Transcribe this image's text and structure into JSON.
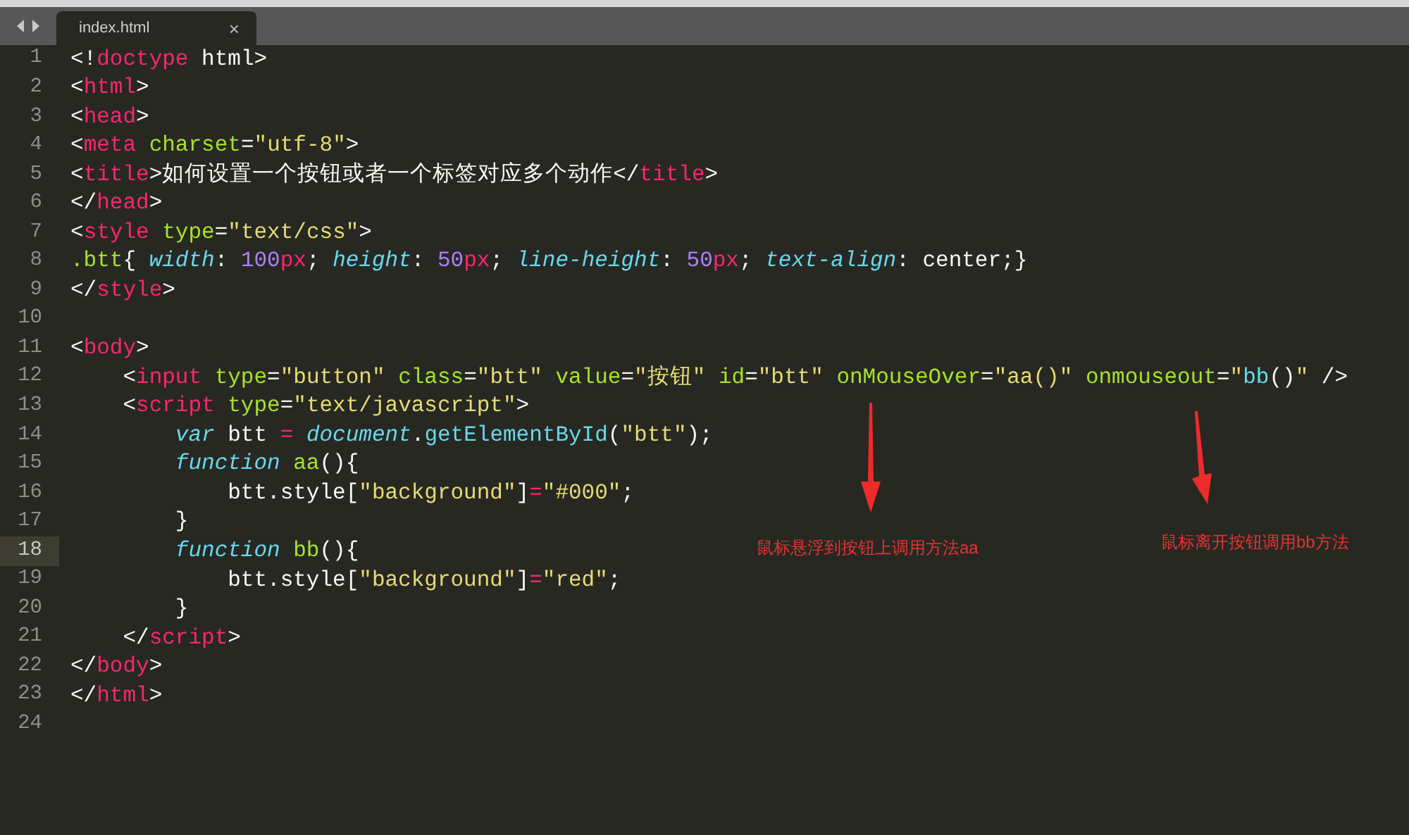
{
  "tab": {
    "title": "index.html",
    "close": "×"
  },
  "lines": [
    {
      "number": "1",
      "current": false,
      "tokens": [
        {
          "kind": "plain",
          "text": "<!"
        },
        {
          "kind": "tag",
          "text": "doctype"
        },
        {
          "kind": "plain",
          "text": " html>"
        }
      ]
    },
    {
      "number": "2",
      "current": false,
      "tokens": [
        {
          "kind": "plain",
          "text": "<"
        },
        {
          "kind": "tag",
          "text": "html"
        },
        {
          "kind": "plain",
          "text": ">"
        }
      ]
    },
    {
      "number": "3",
      "current": false,
      "tokens": [
        {
          "kind": "plain",
          "text": "<"
        },
        {
          "kind": "tag",
          "text": "head"
        },
        {
          "kind": "plain",
          "text": ">"
        }
      ]
    },
    {
      "number": "4",
      "current": false,
      "tokens": [
        {
          "kind": "plain",
          "text": "<"
        },
        {
          "kind": "tag",
          "text": "meta"
        },
        {
          "kind": "attr",
          "text": " charset"
        },
        {
          "kind": "plain",
          "text": "="
        },
        {
          "kind": "string",
          "text": "\"utf-8\""
        },
        {
          "kind": "plain",
          "text": ">"
        }
      ]
    },
    {
      "number": "5",
      "current": false,
      "tokens": [
        {
          "kind": "plain",
          "text": "<"
        },
        {
          "kind": "tag",
          "text": "title"
        },
        {
          "kind": "plain",
          "text": ">如何设置一个按钮或者一个标签对应多个动作</"
        },
        {
          "kind": "tag",
          "text": "title"
        },
        {
          "kind": "plain",
          "text": ">"
        }
      ]
    },
    {
      "number": "6",
      "current": false,
      "tokens": [
        {
          "kind": "plain",
          "text": "</"
        },
        {
          "kind": "tag",
          "text": "head"
        },
        {
          "kind": "plain",
          "text": ">"
        }
      ]
    },
    {
      "number": "7",
      "current": false,
      "tokens": [
        {
          "kind": "plain",
          "text": "<"
        },
        {
          "kind": "tag",
          "text": "style"
        },
        {
          "kind": "attr",
          "text": " type"
        },
        {
          "kind": "plain",
          "text": "="
        },
        {
          "kind": "string",
          "text": "\"text/css\""
        },
        {
          "kind": "plain",
          "text": ">"
        }
      ]
    },
    {
      "number": "8",
      "current": false,
      "tokens": [
        {
          "kind": "attr",
          "text": ".btt"
        },
        {
          "kind": "plain",
          "text": "{ "
        },
        {
          "kind": "keyword",
          "text": "width"
        },
        {
          "kind": "plain",
          "text": ": "
        },
        {
          "kind": "number",
          "text": "100"
        },
        {
          "kind": "tag",
          "text": "px"
        },
        {
          "kind": "plain",
          "text": "; "
        },
        {
          "kind": "keyword",
          "text": "height"
        },
        {
          "kind": "plain",
          "text": ": "
        },
        {
          "kind": "number",
          "text": "50"
        },
        {
          "kind": "tag",
          "text": "px"
        },
        {
          "kind": "plain",
          "text": "; "
        },
        {
          "kind": "keyword",
          "text": "line-height"
        },
        {
          "kind": "plain",
          "text": ": "
        },
        {
          "kind": "number",
          "text": "50"
        },
        {
          "kind": "tag",
          "text": "px"
        },
        {
          "kind": "plain",
          "text": "; "
        },
        {
          "kind": "keyword",
          "text": "text-align"
        },
        {
          "kind": "plain",
          "text": ": center;}"
        }
      ]
    },
    {
      "number": "9",
      "current": false,
      "tokens": [
        {
          "kind": "plain",
          "text": "</"
        },
        {
          "kind": "tag",
          "text": "style"
        },
        {
          "kind": "plain",
          "text": ">"
        }
      ]
    },
    {
      "number": "10",
      "current": false
    },
    {
      "number": "11",
      "current": false,
      "tokens": [
        {
          "kind": "plain",
          "text": "<"
        },
        {
          "kind": "tag",
          "text": "body"
        },
        {
          "kind": "plain",
          "text": ">"
        }
      ]
    },
    {
      "number": "12",
      "current": false,
      "tokens": [
        {
          "kind": "plain",
          "text": "    <"
        },
        {
          "kind": "tag",
          "text": "input"
        },
        {
          "kind": "attr",
          "text": " type"
        },
        {
          "kind": "plain",
          "text": "="
        },
        {
          "kind": "string",
          "text": "\"button\""
        },
        {
          "kind": "attr",
          "text": " class"
        },
        {
          "kind": "plain",
          "text": "="
        },
        {
          "kind": "string",
          "text": "\"btt\""
        },
        {
          "kind": "attr",
          "text": " value"
        },
        {
          "kind": "plain",
          "text": "="
        },
        {
          "kind": "string",
          "text": "\"按钮\""
        },
        {
          "kind": "attr",
          "text": " id"
        },
        {
          "kind": "plain",
          "text": "="
        },
        {
          "kind": "string",
          "text": "\"btt\""
        },
        {
          "kind": "attr",
          "text": " onMouseOver"
        },
        {
          "kind": "plain",
          "text": "="
        },
        {
          "kind": "string",
          "text": "\"aa()\""
        },
        {
          "kind": "attr",
          "text": " onmouseout"
        },
        {
          "kind": "plain",
          "text": "="
        },
        {
          "kind": "string",
          "text": "\""
        },
        {
          "kind": "func",
          "text": "bb"
        },
        {
          "kind": "plain",
          "text": "()"
        },
        {
          "kind": "string",
          "text": "\""
        },
        {
          "kind": "plain",
          "text": " />"
        }
      ]
    },
    {
      "number": "13",
      "current": false,
      "tokens": [
        {
          "kind": "plain",
          "text": "    <"
        },
        {
          "kind": "tag",
          "text": "script"
        },
        {
          "kind": "attr",
          "text": " type"
        },
        {
          "kind": "plain",
          "text": "="
        },
        {
          "kind": "string",
          "text": "\"text/javascript\""
        },
        {
          "kind": "plain",
          "text": ">"
        }
      ]
    },
    {
      "number": "14",
      "current": false,
      "tokens": [
        {
          "kind": "keyword",
          "text": "        var"
        },
        {
          "kind": "plain",
          "text": " btt "
        },
        {
          "kind": "tag",
          "text": "= "
        },
        {
          "kind": "keyword",
          "text": "document"
        },
        {
          "kind": "plain",
          "text": "."
        },
        {
          "kind": "func",
          "text": "getElementById"
        },
        {
          "kind": "plain",
          "text": "("
        },
        {
          "kind": "string",
          "text": "\"btt\""
        },
        {
          "kind": "plain",
          "text": ");"
        }
      ]
    },
    {
      "number": "15",
      "current": false,
      "tokens": [
        {
          "kind": "keyword",
          "text": "        function"
        },
        {
          "kind": "attr",
          "text": " aa"
        },
        {
          "kind": "plain",
          "text": "(){"
        }
      ]
    },
    {
      "number": "16",
      "current": false,
      "tokens": [
        {
          "kind": "plain",
          "text": "            btt.style["
        },
        {
          "kind": "string",
          "text": "\"background\""
        },
        {
          "kind": "plain",
          "text": "]"
        },
        {
          "kind": "tag",
          "text": "="
        },
        {
          "kind": "string",
          "text": "\"#000\""
        },
        {
          "kind": "plain",
          "text": ";"
        }
      ]
    },
    {
      "number": "17",
      "current": false,
      "tokens": [
        {
          "kind": "plain",
          "text": "        }"
        }
      ]
    },
    {
      "number": "18",
      "current": true,
      "tokens": [
        {
          "kind": "keyword",
          "text": "        function"
        },
        {
          "kind": "attr",
          "text": " bb"
        },
        {
          "kind": "plain",
          "text": "(){"
        }
      ]
    },
    {
      "number": "19",
      "current": false,
      "tokens": [
        {
          "kind": "plain",
          "text": "            btt.style["
        },
        {
          "kind": "string",
          "text": "\"background\""
        },
        {
          "kind": "plain",
          "text": "]"
        },
        {
          "kind": "tag",
          "text": "="
        },
        {
          "kind": "string",
          "text": "\"red\""
        },
        {
          "kind": "plain",
          "text": ";"
        }
      ]
    },
    {
      "number": "20",
      "current": false,
      "tokens": [
        {
          "kind": "plain",
          "text": "        }"
        }
      ]
    },
    {
      "number": "21",
      "current": false,
      "tokens": [
        {
          "kind": "plain",
          "text": "    </"
        },
        {
          "kind": "tag",
          "text": "script"
        },
        {
          "kind": "plain",
          "text": ">"
        }
      ]
    },
    {
      "number": "22",
      "current": false,
      "tokens": [
        {
          "kind": "plain",
          "text": "</"
        },
        {
          "kind": "tag",
          "text": "body"
        },
        {
          "kind": "plain",
          "text": ">"
        }
      ]
    },
    {
      "number": "23",
      "current": false,
      "tokens": [
        {
          "kind": "plain",
          "text": "</"
        },
        {
          "kind": "tag",
          "text": "html"
        },
        {
          "kind": "plain",
          "text": ">"
        }
      ]
    },
    {
      "number": "24",
      "current": false
    }
  ],
  "annotations": [
    {
      "text": "鼠标悬浮到按钮上调用方法aa"
    },
    {
      "text": "鼠标离开按钮调用bb方法"
    }
  ]
}
